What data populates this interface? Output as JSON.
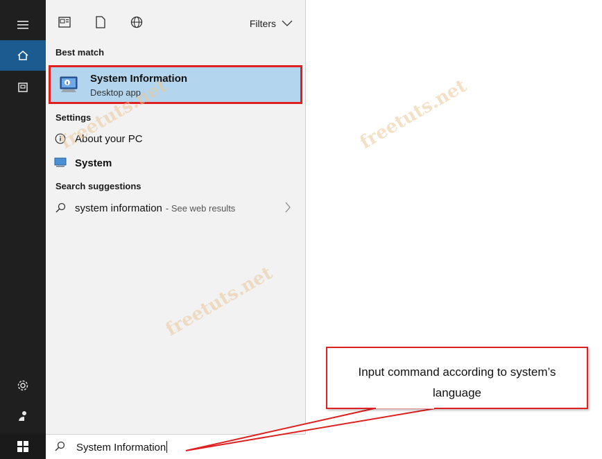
{
  "rail": {
    "items": [
      {
        "name": "hamburger-icon"
      },
      {
        "name": "home-icon",
        "active": true
      },
      {
        "name": "documents-icon"
      }
    ],
    "bottom_items": [
      {
        "name": "settings-icon"
      },
      {
        "name": "user-icon"
      }
    ]
  },
  "toolbar": {
    "filters_label": "Filters"
  },
  "sections": {
    "best_match_label": "Best match",
    "settings_label": "Settings",
    "suggestions_label": "Search suggestions"
  },
  "best_match": {
    "title": "System Information",
    "subtitle": "Desktop app"
  },
  "settings_items": [
    {
      "label": "About your PC",
      "icon": "info-icon"
    },
    {
      "label": "System",
      "icon": "monitor-icon"
    }
  ],
  "suggestion": {
    "label": "system information",
    "hint": "- See web results"
  },
  "search": {
    "value": "System Information"
  },
  "callout": {
    "line1": "Input command according to system’s",
    "line2": "language"
  },
  "watermark": "freetuts.net",
  "colors": {
    "rail_bg": "#1f1f1f",
    "active_blue": "#1c5b8f",
    "selection_bg": "#b3d6ee",
    "highlight_red": "#e02020"
  }
}
